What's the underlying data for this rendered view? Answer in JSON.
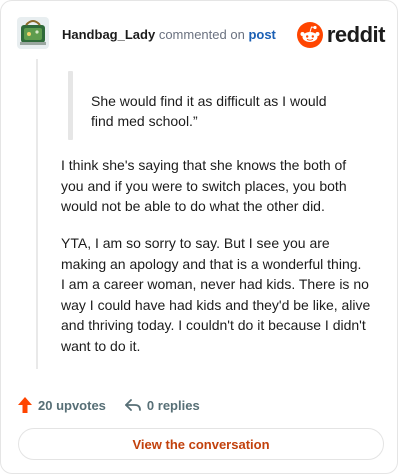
{
  "header": {
    "author": "Handbag_Lady",
    "action_text": "commented on",
    "target_text": "post",
    "logo_text": "reddit"
  },
  "comment": {
    "quote_lines": [
      "She would find it as difficult as I would",
      "find med school.”"
    ],
    "paragraphs": [
      [
        "I think she's saying that she knows the both of",
        "you and if you were to switch places, you both",
        "would not be able to do what the other did."
      ],
      [
        "YTA, I am so sorry to say. But I see you are",
        "making an apology and that is a wonderful thing.",
        "I am a career woman, never had kids. There is no",
        "way I could have had kids and they'd be like, alive",
        "and thriving today. I couldn't do it because I didn't",
        "want to do it."
      ]
    ]
  },
  "actions": {
    "upvotes_label": "20 upvotes",
    "replies_label": "0 replies"
  },
  "cta": {
    "label": "View the conversation"
  },
  "colors": {
    "brand": "#ff4500",
    "upvote": "#ff4500",
    "cta_text": "#c2410c",
    "link": "#1a5fb4"
  },
  "icons": [
    "avatar",
    "reddit-logo-icon",
    "upvote-arrow-icon",
    "reply-icon"
  ]
}
